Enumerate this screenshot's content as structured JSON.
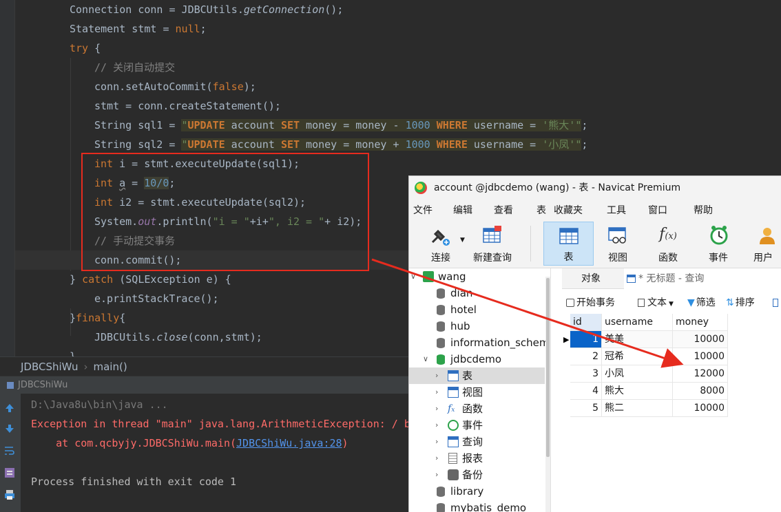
{
  "editor": {
    "lines": [
      {
        "id": "l1",
        "parts": [
          [
            "",
            "Connection conn = JDBCUtils."
          ],
          [
            "it",
            "getConnection"
          ],
          [
            "",
            "();"
          ]
        ]
      },
      {
        "id": "l2",
        "parts": [
          [
            "",
            "Statement stmt = "
          ],
          [
            "kw",
            "null"
          ],
          [
            "",
            ";"
          ]
        ]
      },
      {
        "id": "l3",
        "parts": [
          [
            "kw",
            "try"
          ],
          [
            "",
            " {"
          ]
        ]
      },
      {
        "id": "l4",
        "parts": [
          [
            "cm",
            "// 关闭自动提交"
          ]
        ]
      },
      {
        "id": "l5",
        "parts": [
          [
            "",
            "conn.setAutoCommit("
          ],
          [
            "kw",
            "false"
          ],
          [
            "",
            ");"
          ]
        ]
      },
      {
        "id": "l6",
        "parts": [
          [
            "",
            "stmt = conn.createStatement();"
          ]
        ]
      },
      {
        "id": "l7",
        "parts": [
          [
            "",
            "String sql1 = "
          ],
          [
            "str",
            "\""
          ],
          [
            "sqlkw",
            "UPDATE"
          ],
          [
            "sqlid",
            " account "
          ],
          [
            "sqlkw",
            "SET"
          ],
          [
            "sqlid",
            " money = money - "
          ],
          [
            "num",
            "1000"
          ],
          [
            "sqlid",
            " "
          ],
          [
            "sqlkw",
            "WHERE"
          ],
          [
            "sqlid",
            " username = "
          ],
          [
            "str",
            "'熊大'"
          ],
          [
            "str",
            "\""
          ],
          [
            "",
            ";"
          ]
        ]
      },
      {
        "id": "l8",
        "parts": [
          [
            "",
            "String sql2 = "
          ],
          [
            "str",
            "\""
          ],
          [
            "sqlkw",
            "UPDATE"
          ],
          [
            "sqlid",
            " account "
          ],
          [
            "sqlkw",
            "SET"
          ],
          [
            "sqlid",
            " money = money + "
          ],
          [
            "num",
            "1000"
          ],
          [
            "sqlid",
            " "
          ],
          [
            "sqlkw",
            "WHERE"
          ],
          [
            "sqlid",
            " username = "
          ],
          [
            "str",
            "'小凤'"
          ],
          [
            "str",
            "\""
          ],
          [
            "",
            ";"
          ]
        ]
      },
      {
        "id": "l9",
        "parts": [
          [
            "kw",
            "int"
          ],
          [
            "",
            " i = stmt.executeUpdate(sql1);"
          ]
        ]
      },
      {
        "id": "l10",
        "parts": [
          [
            "kw",
            "int"
          ],
          [
            "",
            " "
          ],
          [
            "ul",
            "a"
          ],
          [
            "",
            " = "
          ],
          [
            "warn",
            "10/0"
          ],
          [
            "",
            ";"
          ]
        ]
      },
      {
        "id": "l11",
        "parts": [
          [
            "kw",
            "int"
          ],
          [
            "",
            " i2 = stmt.executeUpdate(sql2);"
          ]
        ]
      },
      {
        "id": "l12",
        "parts": [
          [
            "",
            "System."
          ],
          [
            "fld",
            "out"
          ],
          [
            "",
            ".println("
          ],
          [
            "str",
            "\"i = \""
          ],
          [
            "",
            "+i+"
          ],
          [
            "str",
            "\", i2 = \""
          ],
          [
            "",
            "+ i2);"
          ]
        ]
      },
      {
        "id": "l13",
        "parts": [
          [
            "cm",
            "// 手动提交事务"
          ]
        ]
      },
      {
        "id": "l14",
        "parts": [
          [
            "",
            "conn.commit();"
          ]
        ]
      },
      {
        "id": "l15",
        "parts": [
          [
            "",
            "} "
          ],
          [
            "kw",
            "catch"
          ],
          [
            "",
            " (SQLException e) {"
          ]
        ]
      },
      {
        "id": "l16",
        "parts": [
          [
            "",
            "e.printStackTrace();"
          ]
        ]
      },
      {
        "id": "l17",
        "parts": [
          [
            "",
            "}"
          ],
          [
            "kw",
            "finally"
          ],
          [
            "",
            "{"
          ]
        ]
      },
      {
        "id": "l18",
        "parts": [
          [
            "",
            "JDBCUtils."
          ],
          [
            "it",
            "close"
          ],
          [
            "",
            "(conn,stmt);"
          ]
        ]
      },
      {
        "id": "l19",
        "parts": [
          [
            "",
            "}"
          ]
        ]
      }
    ]
  },
  "breadcrumb": {
    "class_name": "JDBCShiWu",
    "method": "main()"
  },
  "run_panel": {
    "tab_label": "JDBCShiWu",
    "console": {
      "cmd": "D:\\Java8u\\bin\\java ...",
      "exception": "Exception in thread \"main\" java.lang.ArithmeticException: / by zero",
      "trace_prefix": "    at com.qcbyjy.JDBCShiWu.main(",
      "trace_link": "JDBCShiWu.java:28",
      "trace_suffix": ")",
      "exit": "Process finished with exit code 1"
    }
  },
  "navicat": {
    "title": "account @jdbcdemo (wang) - 表 - Navicat Premium",
    "menu": [
      "文件",
      "编辑",
      "查看",
      "表",
      "收藏夹",
      "工具",
      "窗口",
      "帮助"
    ],
    "toolbar": [
      "连接",
      "新建查询",
      "表",
      "视图",
      "函数",
      "事件",
      "用户"
    ],
    "tree": {
      "connection": "wang",
      "databases": [
        "dian",
        "hotel",
        "hub",
        "information_schema",
        "jdbcdemo"
      ],
      "jdbcdemo_children": [
        "表",
        "视图",
        "函数",
        "事件",
        "查询",
        "报表",
        "备份"
      ],
      "more_databases": [
        "library",
        "mybatis_demo"
      ]
    },
    "tabs": {
      "objects": "对象",
      "query": "* 无标题 - 查询"
    },
    "subbar": {
      "begin": "开始事务",
      "text": "文本",
      "filter": "筛选",
      "sort": "排序"
    },
    "grid": {
      "columns": [
        "id",
        "username",
        "money"
      ],
      "rows": [
        [
          "1",
          "美美",
          "10000"
        ],
        [
          "2",
          "冠希",
          "10000"
        ],
        [
          "3",
          "小凤",
          "12000"
        ],
        [
          "4",
          "熊大",
          "8000"
        ],
        [
          "5",
          "熊二",
          "10000"
        ]
      ]
    }
  },
  "colors": {
    "highlight_box": "#e62b1e",
    "arrow": "#e62b1e"
  }
}
